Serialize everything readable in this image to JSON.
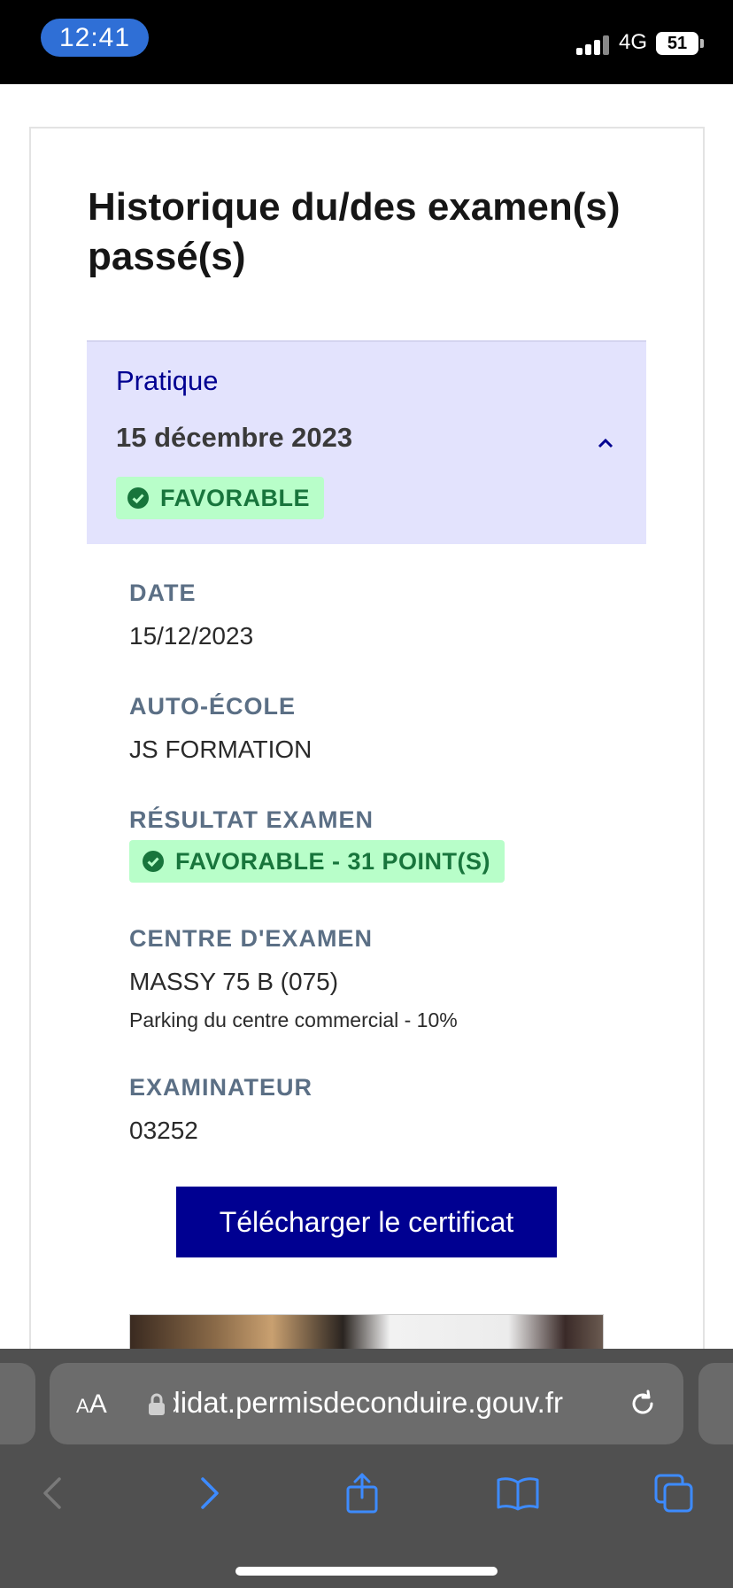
{
  "status_bar": {
    "time": "12:41",
    "network": "4G",
    "battery_level": "51"
  },
  "page": {
    "title": "Historique du/des examen(s) passé(s)"
  },
  "exam": {
    "type": "Pratique",
    "date_heading": "15 décembre 2023",
    "status_badge": "FAVORABLE",
    "expanded": true
  },
  "details": {
    "date_label": "DATE",
    "date_value": "15/12/2023",
    "school_label": "AUTO-ÉCOLE",
    "school_value": "JS FORMATION",
    "result_label": "RÉSULTAT EXAMEN",
    "result_value": "FAVORABLE - 31 POINT(S)",
    "center_label": "CENTRE D'EXAMEN",
    "center_value": "MASSY 75 B (075)",
    "center_sub": "Parking du centre commercial - 10%",
    "examiner_label": "EXAMINATEUR",
    "examiner_value": "03252"
  },
  "actions": {
    "download_label": "Télécharger le certificat"
  },
  "browser": {
    "text_size_small": "A",
    "text_size_large": "A",
    "url": "ndidat.permisdeconduire.gouv.fr",
    "icons": [
      "back-icon",
      "forward-icon",
      "share-icon",
      "bookmarks-icon",
      "tabs-icon",
      "reload-icon",
      "lock-icon"
    ]
  },
  "colors": {
    "accent": "#000091",
    "header_bg": "#e3e3fd",
    "success_bg": "#b8fec9",
    "success_text": "#18753c",
    "label": "#5b6f85"
  }
}
